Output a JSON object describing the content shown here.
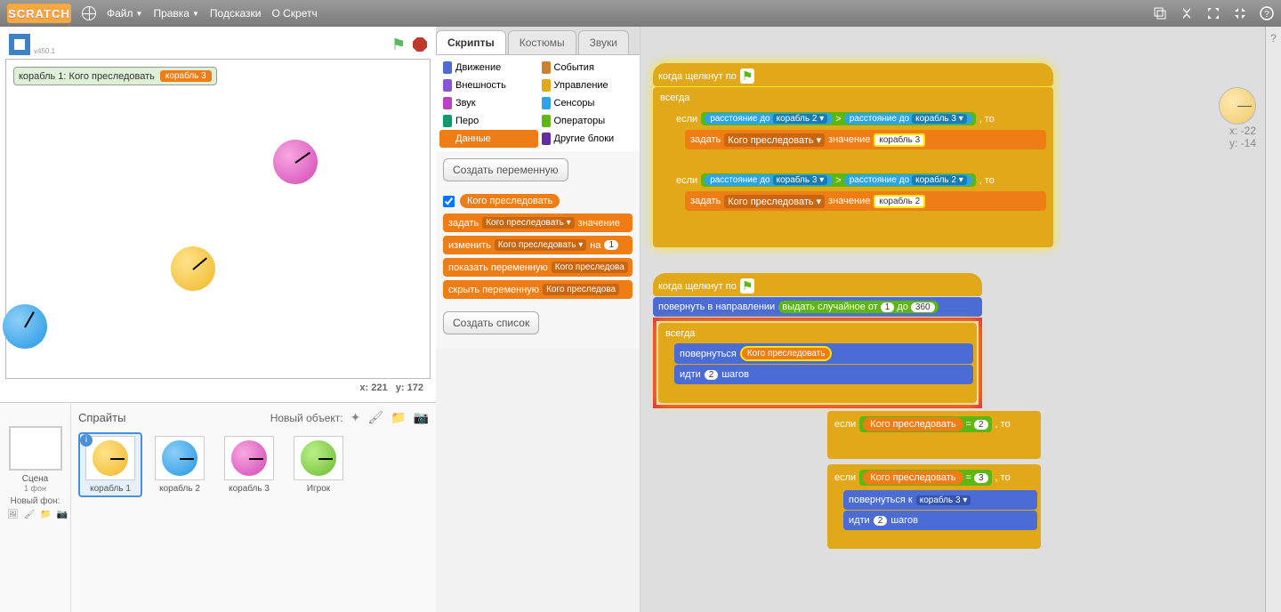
{
  "menubar": {
    "logo": "SCRATCH",
    "file": "Файл",
    "edit": "Правка",
    "tips": "Подсказки",
    "about": "О Скретч"
  },
  "stage": {
    "version": "v450.1",
    "monitor_label": "корабль 1: Кого преследовать",
    "monitor_value": "корабль 3",
    "coords_x_label": "x:",
    "coords_x": "221",
    "coords_y_label": "y:",
    "coords_y": "172"
  },
  "sprite_panel": {
    "backdrop_label": "Сцена",
    "backdrop_count": "1 фон",
    "new_backdrop": "Новый фон:",
    "title": "Спрайты",
    "new_sprite": "Новый объект:",
    "sprites": [
      {
        "name": "корабль 1",
        "selected": true,
        "color": "y"
      },
      {
        "name": "корабль 2",
        "selected": false,
        "color": "b"
      },
      {
        "name": "корабль 3",
        "selected": false,
        "color": "p"
      },
      {
        "name": "Игрок",
        "selected": false,
        "color": "g"
      }
    ]
  },
  "tabs": {
    "scripts": "Скрипты",
    "costumes": "Костюмы",
    "sounds": "Звуки"
  },
  "categories": [
    {
      "name": "Движение",
      "color": "#4a6cd4"
    },
    {
      "name": "События",
      "color": "#c88330"
    },
    {
      "name": "Внешность",
      "color": "#8a55d7"
    },
    {
      "name": "Управление",
      "color": "#e1a91a"
    },
    {
      "name": "Звук",
      "color": "#bb42c3"
    },
    {
      "name": "Сенсоры",
      "color": "#2ca5e2"
    },
    {
      "name": "Перо",
      "color": "#0e9a6c"
    },
    {
      "name": "Операторы",
      "color": "#5cb712"
    },
    {
      "name": "Данные",
      "color": "#ee7d16",
      "selected": true
    },
    {
      "name": "Другие блоки",
      "color": "#632d99"
    }
  ],
  "palette": {
    "make_var": "Создать переменную",
    "var_name": "Кого преследовать",
    "set": "задать",
    "set_drop": "Кого преследовать",
    "set_tail": "значение",
    "change": "изменить",
    "change_tail": "на",
    "change_val": "1",
    "show": "показать переменную",
    "hide": "скрыть переменную",
    "hide_drop": "Кого преследова",
    "make_list": "Создать список"
  },
  "scripts": {
    "hat_flag": "когда щелкнут по",
    "forever": "всегда",
    "if": "если",
    "then": ", то",
    "dist_to": "расстояние до",
    "ship2": "корабль 2",
    "ship3": "корабль 3",
    "gt": ">",
    "eq": "=",
    "set": "задать",
    "set_var": "Кого преследовать",
    "set_mid": "значение",
    "point_dir": "повернуть в направлении",
    "rand": "выдать случайное от",
    "rand_to": "до",
    "rand_a": "1",
    "rand_b": "360",
    "point_towards": "повернуться",
    "point_towards2": "повернуться к",
    "move": "идти",
    "move_n": "2",
    "move_tail": "шагов",
    "var_pill": "Кого преследовать",
    "two": "2",
    "three": "3"
  },
  "readout": {
    "x_label": "x:",
    "x": "-22",
    "y_label": "y:",
    "y": "-14"
  }
}
